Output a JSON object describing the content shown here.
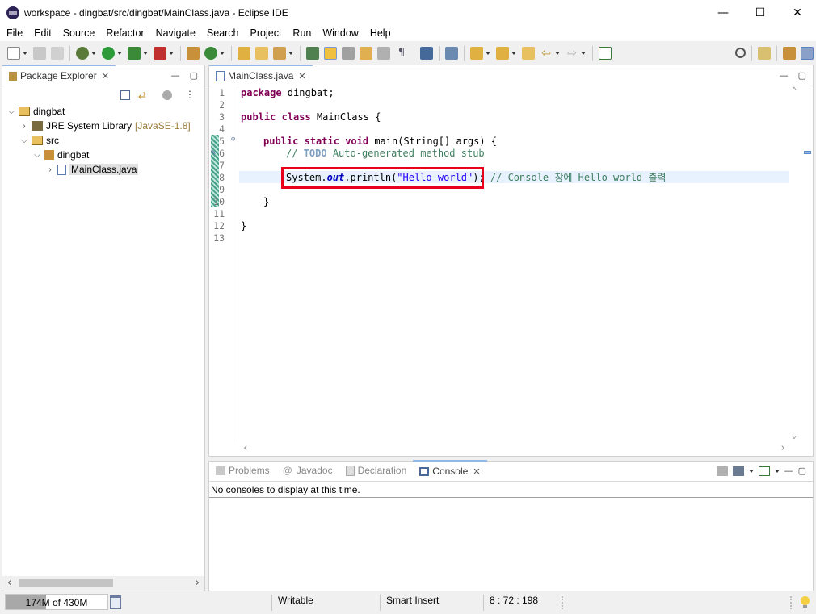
{
  "window": {
    "title": "workspace - dingbat/src/dingbat/MainClass.java - Eclipse IDE"
  },
  "menu": [
    "File",
    "Edit",
    "Source",
    "Refactor",
    "Navigate",
    "Search",
    "Project",
    "Run",
    "Window",
    "Help"
  ],
  "package_explorer": {
    "tab_label": "Package Explorer",
    "tree": {
      "project": "dingbat",
      "jre_label": "JRE System Library",
      "jre_version": "[JavaSE-1.8]",
      "src": "src",
      "package": "dingbat",
      "file": "MainClass.java"
    }
  },
  "editor": {
    "tab_label": "MainClass.java",
    "line_numbers": [
      "1",
      "2",
      "3",
      "4",
      "5",
      "6",
      "7",
      "8",
      "9",
      "10",
      "11",
      "12",
      "13"
    ],
    "code": {
      "l1_kw": "package",
      "l1_rest": " dingbat;",
      "l3_kw1": "public",
      "l3_kw2": "class",
      "l3_rest": " MainClass {",
      "l5_kw1": "public",
      "l5_kw2": "static",
      "l5_kw3": "void",
      "l5_rest": " main(String[] args) {",
      "l6_comment_prefix": "// ",
      "l6_todo": "TODO",
      "l6_comment_rest": " Auto-generated method stub",
      "l8_sys": "System.",
      "l8_out": "out",
      "l8_println": ".println(",
      "l8_str": "\"Hello world\"",
      "l8_end": ");",
      "l8_comment": " // Console 창에 Hello world 출력",
      "l10": "}",
      "l12": "}"
    },
    "highlight_color": "#e8001c"
  },
  "bottom_panel": {
    "tabs": [
      {
        "label": "Problems",
        "active": false
      },
      {
        "label": "Javadoc",
        "active": false
      },
      {
        "label": "Declaration",
        "active": false
      },
      {
        "label": "Console",
        "active": true
      }
    ],
    "message": "No consoles to display at this time."
  },
  "status": {
    "heap": "174M of 430M",
    "heap_used_fraction": 0.4,
    "writable": "Writable",
    "insert_mode": "Smart Insert",
    "position": "8 : 72 : 198"
  }
}
